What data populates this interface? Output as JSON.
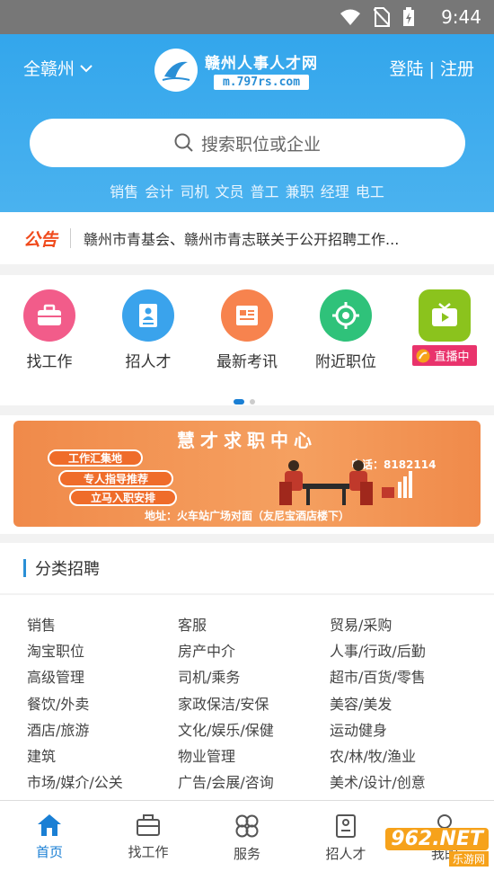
{
  "status_bar": {
    "time": "9:44"
  },
  "header": {
    "city": "全赣州",
    "logo_name": "赣州人事人才网",
    "logo_url": "m.797rs.com",
    "login": "登陆",
    "auth_sep": "|",
    "register": "注册",
    "search_placeholder": "搜索职位或企业",
    "hot_keywords": [
      "销售",
      "会计",
      "司机",
      "文员",
      "普工",
      "兼职",
      "经理",
      "电工"
    ]
  },
  "notice": {
    "tag": "公告",
    "text": "赣州市青基会、赣州市青志联关于公开招聘工作..."
  },
  "menu": {
    "items": [
      {
        "label": "找工作",
        "color": "#f25c8a",
        "icon": "briefcase-icon"
      },
      {
        "label": "招人才",
        "color": "#3aa3ec",
        "icon": "resume-icon"
      },
      {
        "label": "最新考讯",
        "color": "#f7834e",
        "icon": "news-icon"
      },
      {
        "label": "附近职位",
        "color": "#2fc27a",
        "icon": "location-target-icon"
      },
      {
        "label": "直播中",
        "color": "#8bc31d",
        "icon": "tv-icon"
      }
    ],
    "page_dots": {
      "count": 2,
      "active": 0
    }
  },
  "banner": {
    "title": "慧才求职中心",
    "tags": [
      "工作汇集地",
      "专人指导推荐",
      "立马入职安排"
    ],
    "phone": "电话：8182114",
    "address": "地址：火车站广场对面（友尼宝酒店楼下）"
  },
  "categories": {
    "title": "分类招聘",
    "items": [
      "销售",
      "客服",
      "贸易/采购",
      "淘宝职位",
      "房产中介",
      "人事/行政/后勤",
      "高级管理",
      "司机/乘务",
      "超市/百货/零售",
      "餐饮/外卖",
      "家政保洁/安保",
      "美容/美发",
      "酒店/旅游",
      "文化/娱乐/保健",
      "运动健身",
      "建筑",
      "物业管理",
      "农/林/牧/渔业",
      "市场/媒介/公关",
      "广告/会展/咨询",
      "美术/设计/创意"
    ]
  },
  "tabbar": {
    "tabs": [
      {
        "label": "首页",
        "active": true
      },
      {
        "label": "找工作",
        "active": false
      },
      {
        "label": "服务",
        "active": false
      },
      {
        "label": "招人才",
        "active": false
      },
      {
        "label": "我的",
        "active": false
      }
    ]
  },
  "watermark": {
    "main": "962.NET",
    "sub": "乐游网"
  }
}
